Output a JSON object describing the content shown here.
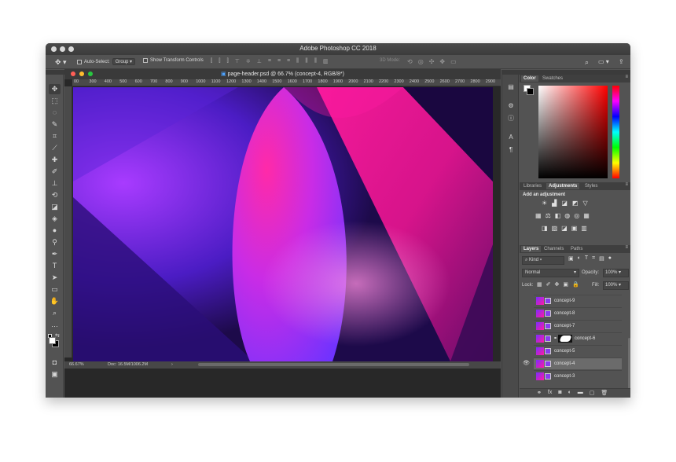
{
  "window": {
    "title": "Adobe Photoshop CC 2018"
  },
  "options_bar": {
    "auto_select_label": "Auto-Select:",
    "auto_select_value": "Group",
    "transform_controls_label": "Show Transform Controls",
    "mode_3d_label": "3D Mode:"
  },
  "document": {
    "tab_title": "page-header.psd @ 66.7% (concept-4, RGB/8*)",
    "ruler_ticks": [
      "00",
      "300",
      "400",
      "500",
      "600",
      "700",
      "800",
      "900",
      "1000",
      "1100",
      "1200",
      "1300",
      "1400",
      "1500",
      "1600",
      "1700",
      "1800",
      "1900",
      "2000",
      "2100",
      "2200",
      "2300",
      "2400",
      "2500",
      "2600",
      "2700",
      "2800",
      "2900"
    ],
    "zoom": "66.67%",
    "doc_size": "Doc: 16.5M/1006.2M"
  },
  "color_panel": {
    "tabs": [
      "Color",
      "Swatches"
    ],
    "active": "Color"
  },
  "adjustments_panel": {
    "tabs": [
      "Libraries",
      "Adjustments",
      "Styles"
    ],
    "active": "Adjustments",
    "heading": "Add an adjustment"
  },
  "layers_panel": {
    "tabs": [
      "Layers",
      "Channels",
      "Paths"
    ],
    "active": "Layers",
    "filter_label": "Kind",
    "blend_mode": "Normal",
    "opacity_label": "Opacity:",
    "opacity_value": "100%",
    "lock_label": "Lock:",
    "fill_label": "Fill:",
    "fill_value": "100%",
    "layers": [
      {
        "name": "concept-9",
        "visible": false,
        "selected": false
      },
      {
        "name": "concept-8",
        "visible": false,
        "selected": false
      },
      {
        "name": "concept-7",
        "visible": false,
        "selected": false
      },
      {
        "name": "concept-6",
        "visible": false,
        "selected": false,
        "has_mask": true
      },
      {
        "name": "concept-5",
        "visible": false,
        "selected": false
      },
      {
        "name": "concept-4",
        "visible": true,
        "selected": true
      },
      {
        "name": "concept-3",
        "visible": false,
        "selected": false
      }
    ],
    "footer_fx": "fx"
  },
  "colors": {
    "ui_dark": "#535353",
    "accent_pink": "#ff1aa3",
    "accent_violet": "#7a2cff",
    "foreground": "#ffffff",
    "background": "#000000"
  }
}
